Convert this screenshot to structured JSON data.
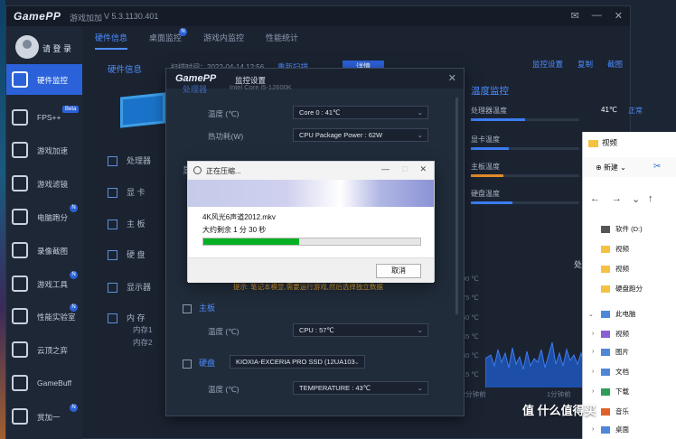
{
  "app": {
    "logo": "GamePP",
    "subtitle": "游戏加加",
    "version": "V 5.3.1130.401",
    "title_buttons": [
      "✉",
      "—",
      "✕"
    ]
  },
  "nav": {
    "user_label": "请 登 录",
    "items": [
      {
        "label": "硬件监控",
        "icon": "monitor-icon",
        "active": true
      },
      {
        "label": "FPS++",
        "icon": "fps-icon",
        "badge": "Beta"
      },
      {
        "label": "游戏加速",
        "icon": "rocket-icon"
      },
      {
        "label": "游戏滤镜",
        "icon": "filter-icon"
      },
      {
        "label": "电脑跑分",
        "icon": "gauge-icon",
        "badge": "N"
      },
      {
        "label": "录像截图",
        "icon": "camera-icon"
      },
      {
        "label": "游戏工具",
        "icon": "tools-icon",
        "badge": "N"
      },
      {
        "label": "性能实验室",
        "icon": "lab-icon",
        "badge": "N"
      },
      {
        "label": "云顶之弈",
        "icon": "tft-icon"
      },
      {
        "label": "GameBuff",
        "icon": "buff-icon"
      },
      {
        "label": "赏加一",
        "icon": "gift-icon",
        "badge": "N"
      }
    ]
  },
  "tabs": [
    {
      "label": "硬件信息",
      "active": true
    },
    {
      "label": "桌面监控",
      "badge": "N"
    },
    {
      "label": "游戏内监控"
    },
    {
      "label": "性能统计"
    }
  ],
  "hardware": {
    "section_title": "硬件信息",
    "scan_time": "扫描时间：2022-04-14 12:56",
    "rescan": "重新扫描",
    "detail": "详情",
    "actions": [
      "监控设置",
      "复制",
      "截图"
    ],
    "rows": [
      "处理器",
      "显  卡",
      "主  板",
      "硬  盘",
      "显示器",
      "内  存"
    ],
    "memory_sub": [
      "内存1",
      "内存2"
    ]
  },
  "temperature": {
    "title": "温度监控",
    "rows": [
      {
        "label": "处理器温度",
        "value": "41℃",
        "status": "正常",
        "fill": 0.5
      },
      {
        "label": "显卡温度",
        "value": "",
        "status": "",
        "fill": 0.35
      },
      {
        "label": "主板温度",
        "value": "",
        "status": "",
        "fill": 0.3
      },
      {
        "label": "硬盘温度",
        "value": "",
        "status": "",
        "fill": 0.38
      }
    ],
    "axis_y": [
      "90 ℃",
      "75 ℃",
      "60 ℃",
      "45 ℃",
      "30 ℃",
      "15 ℃"
    ],
    "axis_x": [
      "2分钟前",
      "1分钟前"
    ],
    "side_label": "处"
  },
  "settings_dialog": {
    "logo": "GamePP",
    "title": "监控设置",
    "top_cut_label": "处理器",
    "top_cut_value": "Intel Core i5-12600K",
    "rows": [
      {
        "label": "温度 (℃)",
        "value": "Core 0 : 41℃"
      },
      {
        "label": "热功耗(W)",
        "value": "CPU Package Power : 62W"
      }
    ],
    "warning": "提示: 笔记本模显,需要运行游戏,然后选择独立数据",
    "sections": [
      {
        "label": "主板",
        "rows": [
          {
            "label": "温度 (℃)",
            "value": "CPU : 57℃"
          }
        ]
      },
      {
        "label": "硬盘",
        "device": "KIOXIA-EXCERIA PRO SSD (12UA103",
        "rows": [
          {
            "label": "温度 (℃)",
            "value": "TEMPERATURE : 43℃"
          }
        ]
      }
    ]
  },
  "zip_dialog": {
    "title": "正在压缩...",
    "file": "4K风光6声道2012.mkv",
    "remaining": "大约剩余 1 分 30 秒",
    "progress": 0.44,
    "cancel": "取消",
    "controls": [
      "—",
      "□",
      "✕"
    ]
  },
  "explorer": {
    "title": "视频",
    "new_label": "新建",
    "items": [
      {
        "label": "软件 (D:)",
        "icon": "drive-icon"
      },
      {
        "label": "视频",
        "icon": "folder-icon"
      },
      {
        "label": "视频",
        "icon": "folder-icon"
      },
      {
        "label": "硬盘跑分",
        "icon": "folder-icon"
      },
      {
        "label": "此电脑",
        "icon": "pc-icon"
      },
      {
        "label": "视频",
        "icon": "video-icon"
      },
      {
        "label": "图片",
        "icon": "picture-icon"
      },
      {
        "label": "文档",
        "icon": "document-icon"
      },
      {
        "label": "下载",
        "icon": "download-icon"
      },
      {
        "label": "音乐",
        "icon": "music-icon"
      },
      {
        "label": "桌面",
        "icon": "desktop-icon"
      }
    ]
  },
  "watermark": "值 什么值得买"
}
